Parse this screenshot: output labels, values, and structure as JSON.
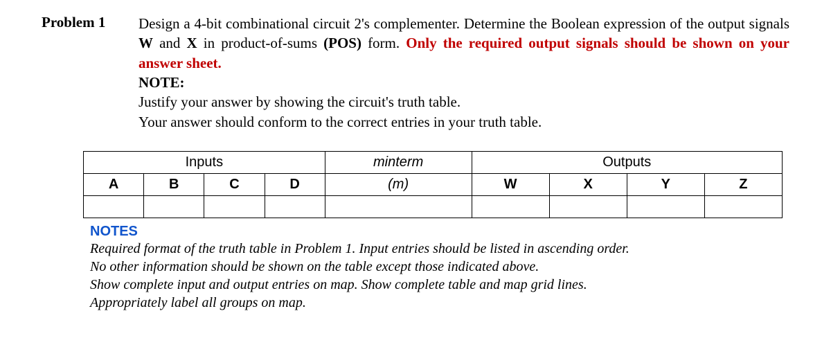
{
  "problem": {
    "label": "Problem 1",
    "text_part1": "Design a 4-bit combinational circuit 2's complementer. Determine the Boolean expression of the output signals ",
    "bold_wx": "W",
    "text_and": " and ",
    "bold_x": "X",
    "text_part2": " in product-of-sums ",
    "bold_pos": "(POS)",
    "text_part3": " form. ",
    "red_text": "Only the required output signals should be shown on your answer sheet.",
    "note_label": "NOTE:",
    "note_line1": "Justify your answer by showing the circuit's truth table.",
    "note_line2": "Your answer should conform to the correct entries in your truth table."
  },
  "table": {
    "group_inputs": "Inputs",
    "group_minterm": "minterm",
    "group_outputs": "Outputs",
    "col_a": "A",
    "col_b": "B",
    "col_c": "C",
    "col_d": "D",
    "col_m": "(m)",
    "col_w": "W",
    "col_x": "X",
    "col_y": "Y",
    "col_z": "Z"
  },
  "notes": {
    "label": "NOTES",
    "line1": "Required format of the truth table in Problem 1. Input entries should be listed in ascending order.",
    "line2": "No other information should be shown on the table except those indicated above.",
    "line3": "Show complete input and output entries on map. Show complete table and map grid lines.",
    "line4": "Appropriately label all groups on map."
  }
}
